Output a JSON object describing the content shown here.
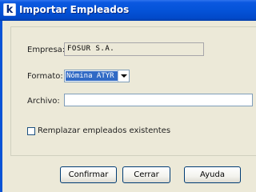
{
  "window": {
    "title": "Importar Empleados",
    "app_icon_glyph": "k"
  },
  "form": {
    "empresa_label": "Empresa:",
    "empresa_value": "FOSUR S.A.",
    "formato_label": "Formato:",
    "formato_value": "Nómina ATYR",
    "archivo_label": "Archivo:",
    "archivo_value": "",
    "replace_label": "Remplazar empleados existentes",
    "replace_checked": false
  },
  "buttons": {
    "confirm": "Confirmar",
    "cancel": "Cerrar",
    "help": "Ayuda"
  },
  "colors": {
    "titlebar": "#0453d8",
    "dialog_bg": "#ece9d8",
    "selection": "#316ac5"
  }
}
